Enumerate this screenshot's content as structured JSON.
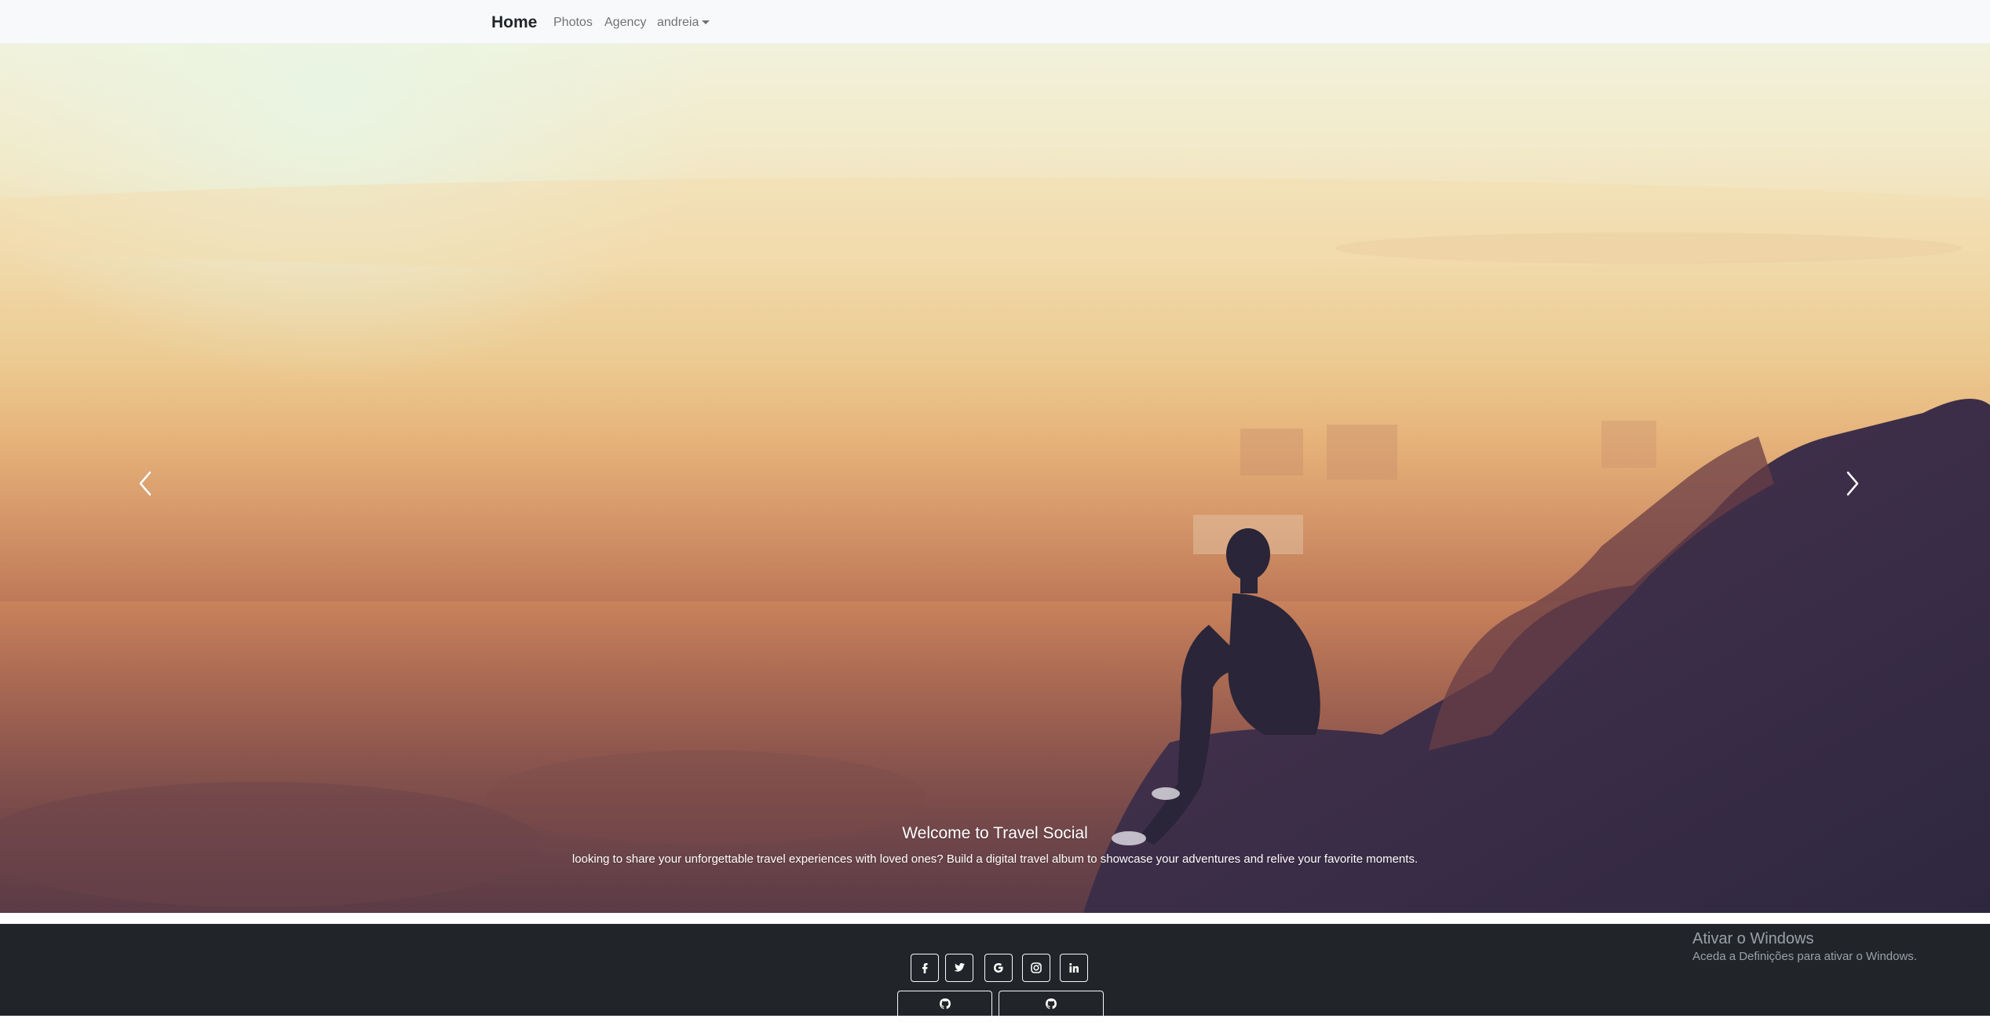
{
  "navbar": {
    "brand": "Home",
    "links": [
      "Photos",
      "Agency"
    ],
    "user_menu": "andreia"
  },
  "hero": {
    "caption_title": "Welcome to Travel Social",
    "caption_text": "looking to share your unforgettable travel experiences with loved ones? Build a digital travel album to showcase your adventures and relive your favorite moments.",
    "controls": {
      "prev_icon": "chevron-left-icon",
      "next_icon": "chevron-right-icon"
    }
  },
  "footer": {
    "social_icons": [
      "facebook-icon",
      "twitter-icon",
      "google-icon",
      "instagram-icon",
      "linkedin-icon"
    ],
    "github_icons": [
      "github-icon",
      "github-icon"
    ]
  },
  "windows_activation": {
    "title": "Ativar o Windows",
    "subtitle": "Aceda a Definições para ativar o Windows."
  },
  "colors": {
    "navbar_bg": "#f8f9fa",
    "footer_bg": "#212529",
    "text_dark": "#212529"
  }
}
